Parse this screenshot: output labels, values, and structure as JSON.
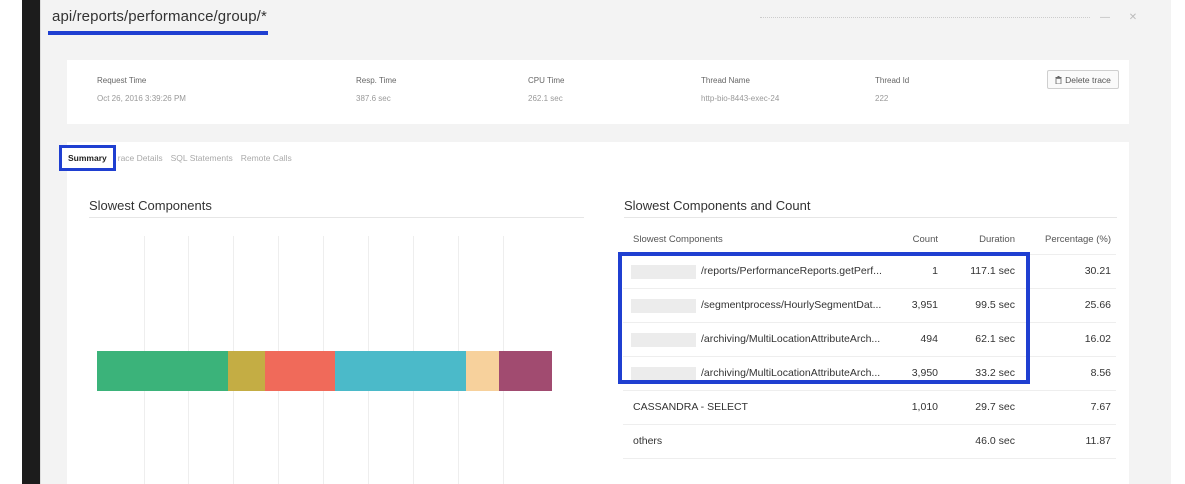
{
  "header": {
    "title": "api/reports/performance/group/*"
  },
  "info": {
    "request_time_label": "Request Time",
    "request_time_value": "Oct 26, 2016 3:39:26 PM",
    "resp_time_label": "Resp. Time",
    "resp_time_value": "387.6 sec",
    "cpu_time_label": "CPU Time",
    "cpu_time_value": "262.1 sec",
    "thread_name_label": "Thread Name",
    "thread_name_value": "http-bio-8443-exec-24",
    "thread_id_label": "Thread Id",
    "thread_id_value": "222",
    "delete_label": "Delete trace"
  },
  "tabs": [
    {
      "label": "Summary"
    },
    {
      "label": "race Details"
    },
    {
      "label": "SQL Statements"
    },
    {
      "label": "Remote Calls"
    }
  ],
  "left_section": {
    "title": "Slowest Components"
  },
  "right_section": {
    "title": "Slowest Components and Count"
  },
  "table": {
    "headers": [
      "Slowest Components",
      "Count",
      "Duration",
      "Percentage (%)"
    ],
    "rows": [
      {
        "name": "/reports/PerformanceReports.getPerf...",
        "count": "1",
        "duration": "117.1 sec",
        "pct": "30.21"
      },
      {
        "name": "/segmentprocess/HourlySegmentDat...",
        "count": "3,951",
        "duration": "99.5 sec",
        "pct": "25.66"
      },
      {
        "name": "/archiving/MultiLocationAttributeArch...",
        "count": "494",
        "duration": "62.1 sec",
        "pct": "16.02"
      },
      {
        "name": "/archiving/MultiLocationAttributeArch...",
        "count": "3,950",
        "duration": "33.2 sec",
        "pct": "8.56"
      },
      {
        "name": "CASSANDRA - SELECT",
        "count": "1,010",
        "duration": "29.7 sec",
        "pct": "7.67"
      },
      {
        "name": "others",
        "count": "",
        "duration": "46.0 sec",
        "pct": "11.87"
      }
    ]
  },
  "chart_data": {
    "type": "bar",
    "stacked": true,
    "orientation": "horizontal",
    "series": [
      {
        "value": 30.21,
        "color": "#3bb37a"
      },
      {
        "value": 8.56,
        "color": "#c4ad44"
      },
      {
        "value": 16.02,
        "color": "#f06a5a"
      },
      {
        "value": 30.21,
        "color": "#4bbac9"
      },
      {
        "value": 7.67,
        "color": "#f7d19c"
      },
      {
        "value": 11.87,
        "color": "#a14b70"
      }
    ]
  },
  "colors": {
    "highlight": "#1f3fd1"
  }
}
